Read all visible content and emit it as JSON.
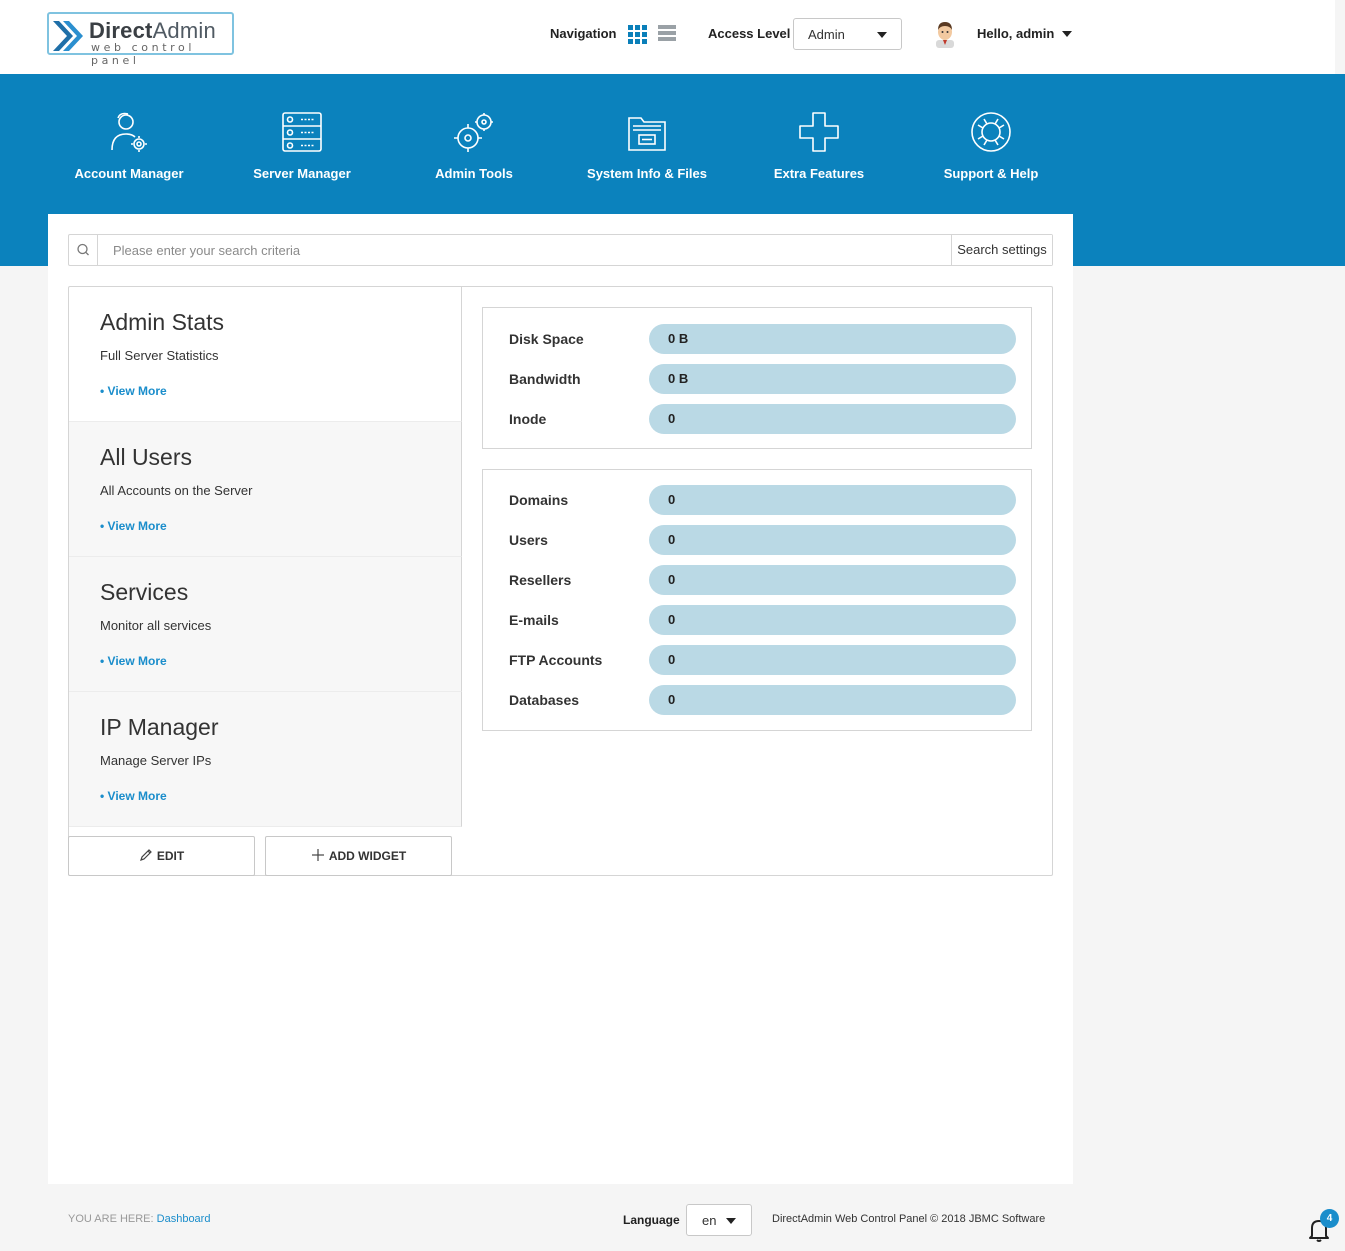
{
  "header": {
    "logo_brand_primary": "Direct",
    "logo_brand_secondary": "Admin",
    "logo_tagline": "web control panel",
    "navigation_label": "Navigation",
    "access_level_label": "Access Level",
    "access_level_value": "Admin",
    "greeting": "Hello, admin"
  },
  "main_menu": [
    {
      "label": "Account Manager",
      "icon": "users-gear-icon"
    },
    {
      "label": "Server Manager",
      "icon": "server-icon"
    },
    {
      "label": "Admin Tools",
      "icon": "tools-icon"
    },
    {
      "label": "System Info & Files",
      "icon": "folder-icon"
    },
    {
      "label": "Extra Features",
      "icon": "plus-icon"
    },
    {
      "label": "Support & Help",
      "icon": "lifebuoy-icon"
    }
  ],
  "search": {
    "placeholder": "Please enter your search criteria",
    "settings_label": "Search settings"
  },
  "widgets": [
    {
      "title": "Admin Stats",
      "subtitle": "Full Server Statistics",
      "link": "View More"
    },
    {
      "title": "All Users",
      "subtitle": "All Accounts on the Server",
      "link": "View More"
    },
    {
      "title": "Services",
      "subtitle": "Monitor all services",
      "link": "View More"
    },
    {
      "title": "IP Manager",
      "subtitle": "Manage Server IPs",
      "link": "View More"
    }
  ],
  "buttons": {
    "edit": "EDIT",
    "add_widget": "ADD WIDGET"
  },
  "stats_usage": [
    {
      "label": "Disk Space",
      "value": "0 B",
      "fill": 0
    },
    {
      "label": "Bandwidth",
      "value": "0 B",
      "fill": 0
    },
    {
      "label": "Inode",
      "value": "0",
      "fill": 0
    }
  ],
  "stats_counts": [
    {
      "label": "Domains",
      "value": "0",
      "fill": 0
    },
    {
      "label": "Users",
      "value": "0",
      "fill": 0
    },
    {
      "label": "Resellers",
      "value": "0",
      "fill": 0
    },
    {
      "label": "E-mails",
      "value": "0",
      "fill": 0
    },
    {
      "label": "FTP Accounts",
      "value": "0",
      "fill": 0
    },
    {
      "label": "Databases",
      "value": "0",
      "fill": 0
    }
  ],
  "footer": {
    "you_are_here_label": "YOU ARE HERE:",
    "breadcrumb": "Dashboard",
    "language_label": "Language",
    "language_value": "en",
    "copyright": "DirectAdmin Web Control Panel © 2018 JBMC Software",
    "notification_count": "4"
  },
  "colors": {
    "brand_blue": "#0b82bd",
    "stat_bar": "#bad9e5",
    "link_blue": "#1a8dcb"
  }
}
